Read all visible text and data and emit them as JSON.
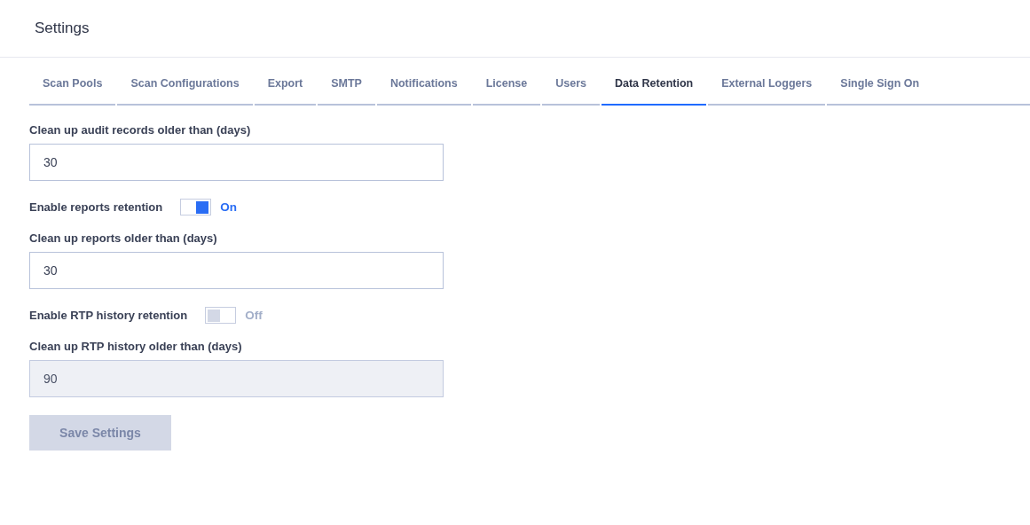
{
  "header": {
    "title": "Settings"
  },
  "tabs": [
    {
      "label": "Scan Pools",
      "selected": false
    },
    {
      "label": "Scan Configurations",
      "selected": false
    },
    {
      "label": "Export",
      "selected": false
    },
    {
      "label": "SMTP",
      "selected": false
    },
    {
      "label": "Notifications",
      "selected": false
    },
    {
      "label": "License",
      "selected": false
    },
    {
      "label": "Users",
      "selected": false
    },
    {
      "label": "Data Retention",
      "selected": true
    },
    {
      "label": "External Loggers",
      "selected": false
    },
    {
      "label": "Single Sign On",
      "selected": false
    }
  ],
  "form": [
    {
      "kind": "field",
      "label": "Clean up audit records older than (days)",
      "value": "30",
      "disabled": false
    },
    {
      "kind": "toggle",
      "label": "Enable reports retention",
      "on": true,
      "status": "On"
    },
    {
      "kind": "field",
      "label": "Clean up reports older than (days)",
      "value": "30",
      "disabled": false
    },
    {
      "kind": "toggle",
      "label": "Enable RTP history retention",
      "on": false,
      "status": "Off"
    },
    {
      "kind": "field",
      "label": "Clean up RTP history older than (days)",
      "value": "90",
      "disabled": true
    }
  ],
  "save_button": {
    "label": "Save Settings",
    "disabled": true
  }
}
